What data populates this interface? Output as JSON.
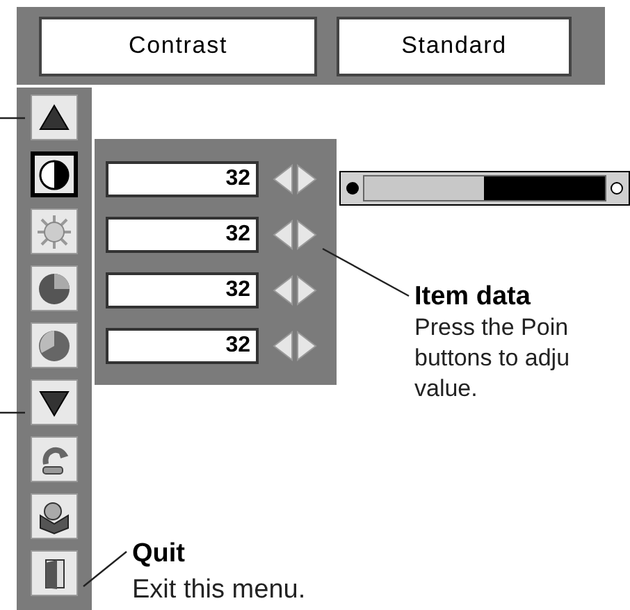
{
  "header": {
    "item": "Contrast",
    "mode": "Standard"
  },
  "menu_icons": [
    {
      "kind": "up",
      "selected": false
    },
    {
      "kind": "contrast",
      "selected": true
    },
    {
      "kind": "brightness",
      "selected": false
    },
    {
      "kind": "color",
      "selected": false
    },
    {
      "kind": "tint",
      "selected": false
    },
    {
      "kind": "down",
      "selected": false
    },
    {
      "kind": "reset",
      "selected": false
    },
    {
      "kind": "store",
      "selected": false
    },
    {
      "kind": "quit",
      "selected": false
    }
  ],
  "values": [
    {
      "value": "32"
    },
    {
      "value": "32"
    },
    {
      "value": "32"
    },
    {
      "value": "32"
    }
  ],
  "slider": {
    "level": 0.5
  },
  "callouts": [
    {
      "kind": "item-data",
      "title": "Item data",
      "lines": [
        "Press the Poin",
        "buttons to adju",
        "value."
      ]
    },
    {
      "kind": "quit",
      "title": "Quit",
      "lines": [
        "Exit this menu."
      ]
    }
  ]
}
